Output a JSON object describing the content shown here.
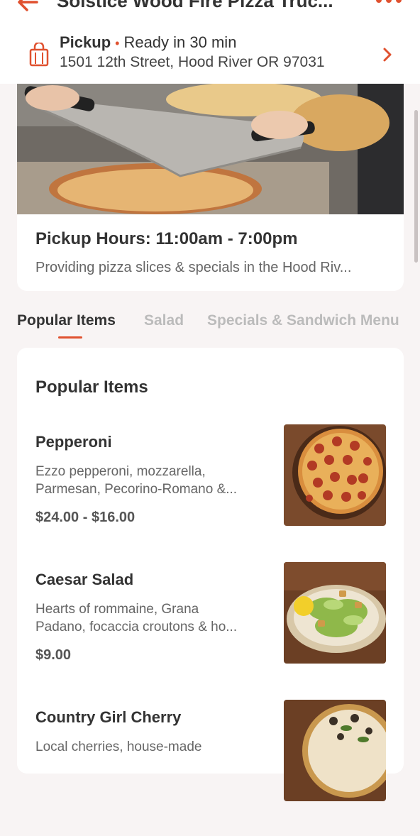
{
  "header": {
    "title": "Solstice Wood Fire Pizza Truc...",
    "pickup_label": "Pickup",
    "ready_text": "Ready in 30 min",
    "address": "1501 12th Street, Hood River OR 97031"
  },
  "store": {
    "hours": "Pickup Hours: 11:00am - 7:00pm",
    "description": "Providing pizza slices & specials in the Hood Riv..."
  },
  "tabs": [
    {
      "label": "Popular Items",
      "active": true
    },
    {
      "label": "Salad",
      "active": false
    },
    {
      "label": "Specials & Sandwich Menu",
      "active": false
    }
  ],
  "section": {
    "title": "Popular Items"
  },
  "items": [
    {
      "name": "Pepperoni",
      "desc_line1": "Ezzo pepperoni, mozzarella,",
      "desc_line2": "Parmesan, Pecorino-Romano &...",
      "price": "$24.00 - $16.00"
    },
    {
      "name": "Caesar Salad",
      "desc_line1": "Hearts of rommaine, Grana",
      "desc_line2": "Padano, focaccia croutons & ho...",
      "price": "$9.00"
    },
    {
      "name": "Country Girl Cherry",
      "desc_line1": "Local cherries, house-made",
      "desc_line2": "",
      "price": ""
    }
  ],
  "colors": {
    "accent": "#e0512f",
    "background": "#f8f4f4",
    "card": "#ffffff"
  }
}
